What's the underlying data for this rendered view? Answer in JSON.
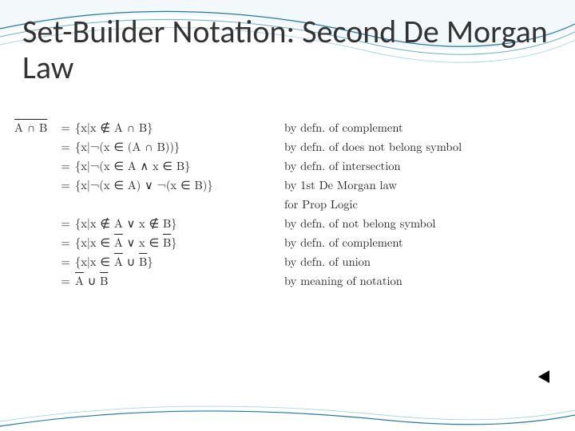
{
  "title": "Set-Builder Notation: Second De Morgan Law",
  "lhs": "A ∩ B",
  "rows": [
    {
      "rhs": "{x|x ∉ A ∩ B}",
      "reason": "by defn. of complement"
    },
    {
      "rhs": "{x|¬(x ∈ (A ∩ B))}",
      "reason": "by defn. of does not belong symbol"
    },
    {
      "rhs": "{x|¬(x ∈ A ∧ x ∈ B}",
      "reason": "by defn. of intersection"
    },
    {
      "rhs": "{x|¬(x ∈ A) ∨ ¬(x ∈ B)}",
      "reason": "by 1st De Morgan law"
    },
    {
      "rhs": "",
      "reason": "for Prop Logic"
    },
    {
      "rhs": "{x|x ∉ A ∨ x ∉ B}",
      "reason": "by defn. of not belong symbol"
    },
    {
      "rhs": "{x|x ∈ A̅ ∨ x ∈ B̅}",
      "reason": "by defn. of complement",
      "rhs_html": "{x|x ∈ <span class=\"ovl\">A</span> ∨ x ∈ <span class=\"ovl\">B</span>}"
    },
    {
      "rhs": "{x|x ∈ A̅ ∪ B̅}",
      "reason": "by defn. of union",
      "rhs_html": "{x|x ∈ <span class=\"ovl\">A</span> ∪ <span class=\"ovl\">B</span>}"
    },
    {
      "rhs": "A̅ ∪ B̅",
      "reason": "by meaning of notation",
      "rhs_html": "<span class=\"ovl\">A</span> ∪ <span class=\"ovl\">B</span>"
    }
  ],
  "eq": "=",
  "back_icon": "back-triangle"
}
